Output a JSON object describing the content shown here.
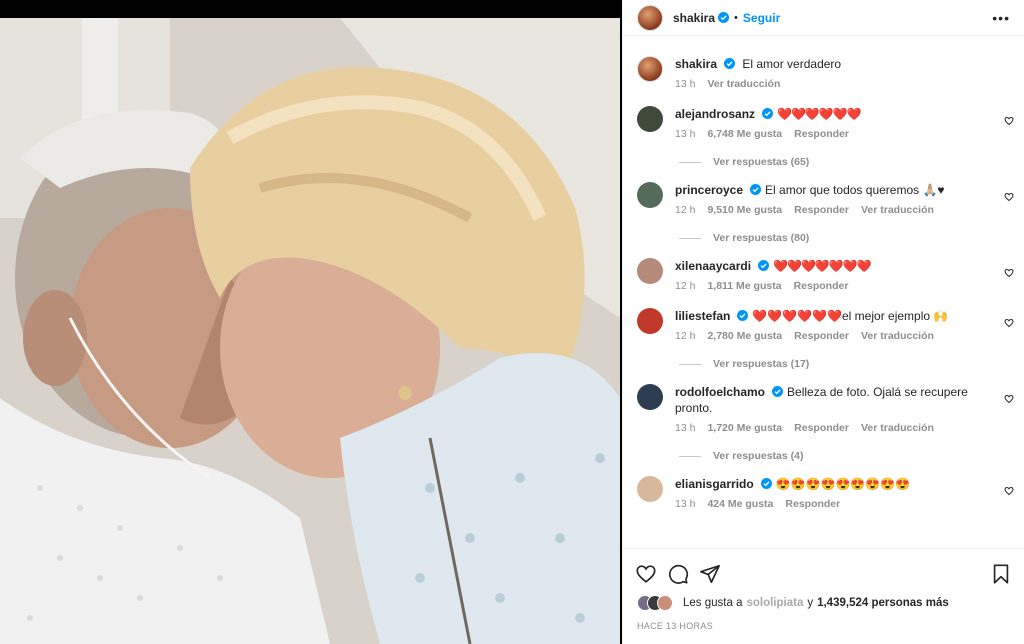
{
  "header": {
    "username": "shakira",
    "follow": "Seguir"
  },
  "caption": {
    "username": "shakira",
    "text": "El amor verdadero",
    "time": "13 h",
    "translate": "Ver traducción"
  },
  "comments": [
    {
      "username": "alejandrosanz",
      "text": "❤️❤️❤️❤️❤️❤️",
      "time": "13 h",
      "likes": "6,748 Me gusta",
      "reply": "Responder",
      "translate": "",
      "replies": "Ver respuestas (65)",
      "avatar_color": "#3f4a3a"
    },
    {
      "username": "princeroyce",
      "text": "El amor que todos queremos 🙏🏼♥",
      "time": "12 h",
      "likes": "9,510 Me gusta",
      "reply": "Responder",
      "translate": "Ver traducción",
      "replies": "Ver respuestas (80)",
      "avatar_color": "#546b5a"
    },
    {
      "username": "xilenaaycardi",
      "text": "❤️❤️❤️❤️❤️❤️❤️",
      "time": "12 h",
      "likes": "1,811 Me gusta",
      "reply": "Responder",
      "translate": "",
      "replies": "",
      "avatar_color": "#b68a7a"
    },
    {
      "username": "liliestefan",
      "text": "❤️❤️❤️❤️❤️❤️el mejor ejemplo 🙌",
      "time": "12 h",
      "likes": "2,780 Me gusta",
      "reply": "Responder",
      "translate": "Ver traducción",
      "replies": "Ver respuestas (17)",
      "avatar_color": "#c0392b"
    },
    {
      "username": "rodolfoelchamo",
      "text": "Belleza de foto. Ojalá se recupere pronto.",
      "time": "13 h",
      "likes": "1,720 Me gusta",
      "reply": "Responder",
      "translate": "Ver traducción",
      "replies": "Ver respuestas (4)",
      "avatar_color": "#2c3e50"
    },
    {
      "username": "elianisgarrido",
      "text": "😍😍😍😍😍😍😍😍😍",
      "time": "13 h",
      "likes": "424 Me gusta",
      "reply": "Responder",
      "translate": "",
      "replies": "",
      "avatar_color": "#d8b89a"
    }
  ],
  "footer": {
    "likes_prefix": "Les gusta a",
    "likes_user": "sololipiata",
    "likes_and": "y",
    "likes_count": "1,439,524 personas más",
    "posted": "HACE 13 HORAS"
  },
  "icons": [
    "verified-badge-icon",
    "more-options-icon",
    "heart-icon",
    "comment-icon",
    "share-icon",
    "bookmark-icon"
  ],
  "colors": {
    "accent": "#0095f6",
    "heart": "#ed1b2e",
    "muted": "#8e8e8e"
  }
}
